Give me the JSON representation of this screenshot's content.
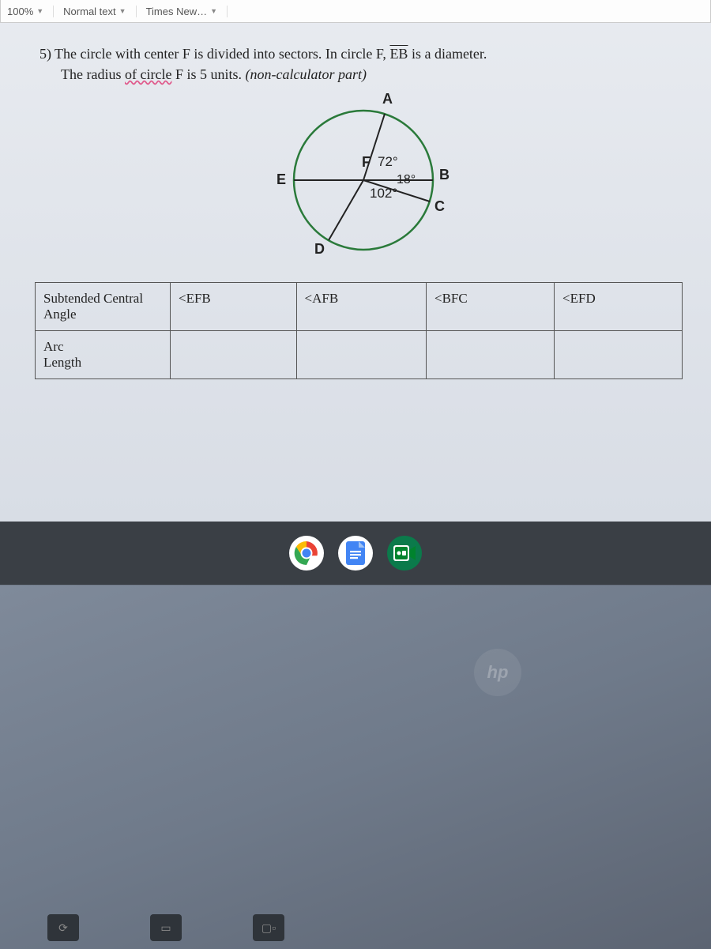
{
  "toolbar": {
    "zoom": "100%",
    "style": "Normal text",
    "font": "Times New…"
  },
  "question": {
    "number": "5)",
    "line1_a": "The circle with center F is divided into sectors. In circle F, ",
    "line1_eb": "EB",
    "line1_b": " is a diameter.",
    "line2_a": "The radius ",
    "line2_err": "of circle",
    "line2_b": " F is 5 units. ",
    "line2_paren": "(non-calculator part)"
  },
  "figure": {
    "A": "A",
    "B": "B",
    "C": "C",
    "D": "D",
    "E": "E",
    "F": "F",
    "ang72": "72°",
    "ang18": "18°",
    "ang102": "102°"
  },
  "table": {
    "row1": "Subtended Central Angle",
    "row2": "Arc\nLength",
    "h1": "<EFB",
    "h2": "<AFB",
    "h3": "<BFC",
    "h4": "<EFD"
  }
}
